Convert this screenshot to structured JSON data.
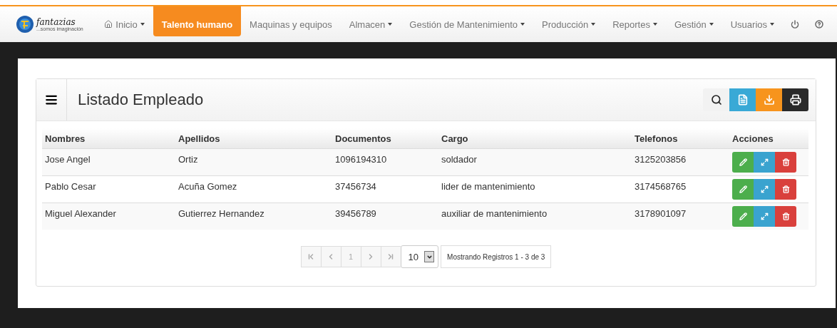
{
  "logo": {
    "name": "fantazias",
    "tagline": "...somos imaginación"
  },
  "nav": [
    {
      "label": "Inicio",
      "kind": "home",
      "caret": true,
      "selected": false
    },
    {
      "label": "Talento humano",
      "kind": "text",
      "caret": false,
      "selected": true
    },
    {
      "label": "Maquinas y equipos",
      "kind": "text",
      "caret": false,
      "selected": false
    },
    {
      "label": "Almacen",
      "kind": "text",
      "caret": true,
      "selected": false
    },
    {
      "label": "Gestión de Mantenimiento",
      "kind": "text",
      "caret": true,
      "selected": false
    },
    {
      "label": "Producción",
      "kind": "text",
      "caret": true,
      "selected": false
    },
    {
      "label": "Reportes",
      "kind": "text",
      "caret": true,
      "selected": false
    },
    {
      "label": "Gestión",
      "kind": "text",
      "caret": true,
      "selected": false
    },
    {
      "label": "Usuarios",
      "kind": "text",
      "caret": true,
      "selected": false
    }
  ],
  "nav_icons": [
    {
      "kind": "power"
    },
    {
      "kind": "help"
    }
  ],
  "panel": {
    "title": "Listado Empleado",
    "tools": [
      {
        "kind": "search"
      },
      {
        "kind": "document"
      },
      {
        "kind": "download"
      },
      {
        "kind": "print"
      }
    ]
  },
  "table": {
    "columns": [
      "Nombres",
      "Apellidos",
      "Documentos",
      "Cargo",
      "Telefonos",
      "Acciones"
    ],
    "rows": [
      [
        "Jose Angel",
        "Ortiz",
        "1096194310",
        "soldador",
        "3125203856"
      ],
      [
        "Pablo Cesar",
        "Acuña Gomez",
        "37456734",
        "lider de mantenimiento",
        "3174568765"
      ],
      [
        "Miguel Alexander",
        "Gutierrez Hernandez",
        "39456789",
        "auxiliar de mantenimiento",
        "3178901097"
      ]
    ]
  },
  "pagination": {
    "buttons": [
      {
        "kind": "first",
        "disabled": true
      },
      {
        "kind": "prev",
        "disabled": true
      },
      {
        "kind": "page",
        "label": "1",
        "disabled": true
      },
      {
        "kind": "next",
        "disabled": true
      },
      {
        "kind": "last",
        "disabled": true
      }
    ],
    "page_size": "10",
    "info": "Mostrando Registros 1 - 3 de 3"
  }
}
